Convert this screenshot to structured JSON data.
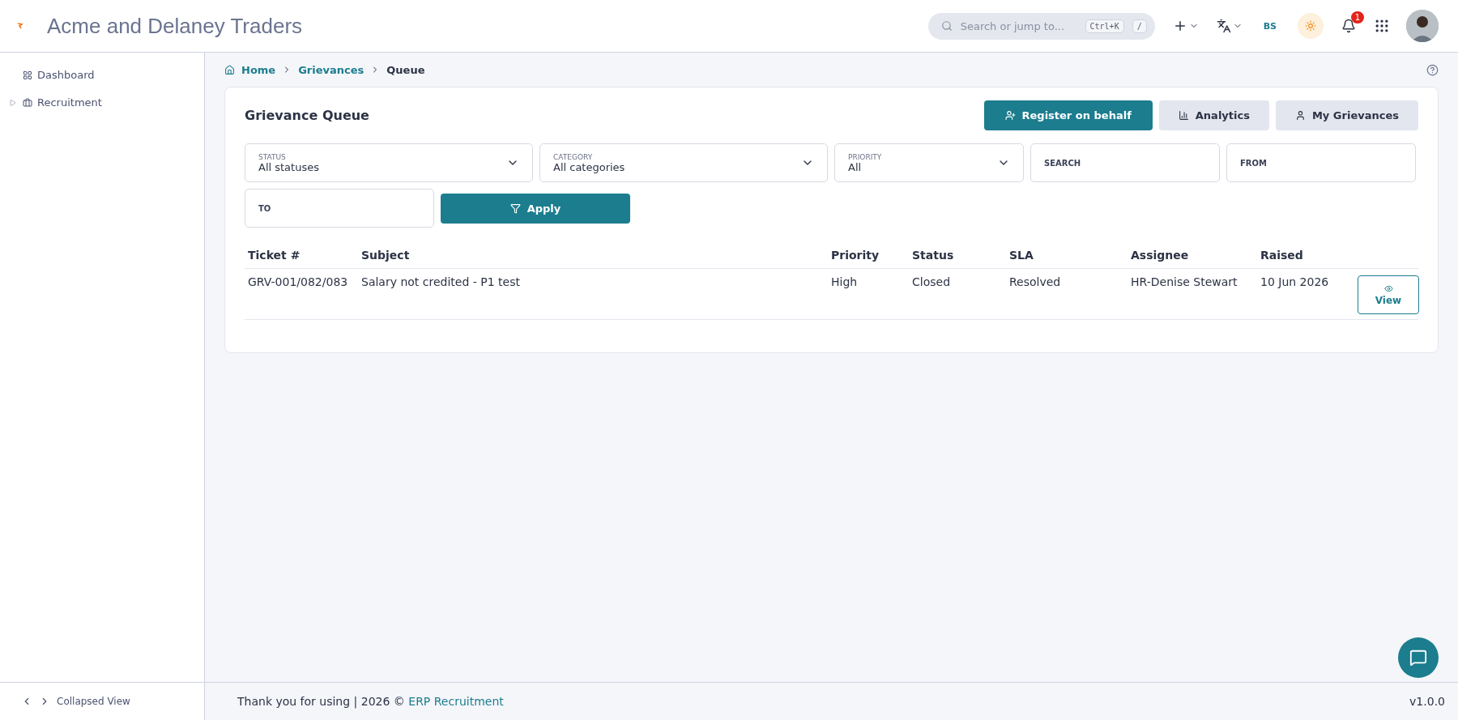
{
  "header": {
    "title": "Acme and Delaney Traders",
    "search": {
      "placeholder": "Search or jump to...",
      "shortcuts": [
        "Ctrl+K",
        "/"
      ]
    },
    "user_initials": "BS",
    "notifications": "1"
  },
  "sidebar": {
    "items": [
      {
        "label": "Dashboard",
        "expandable": false
      },
      {
        "label": "Recruitment",
        "expandable": true
      }
    ],
    "footer": "Collapsed View"
  },
  "breadcrumb": [
    {
      "label": "Home",
      "selected": false
    },
    {
      "label": "Grievances",
      "selected": false
    },
    {
      "label": "Queue",
      "selected": true
    }
  ],
  "card": {
    "title": "Grievance Queue",
    "actions": [
      {
        "label": "Register on behalf",
        "kind": "primary"
      },
      {
        "label": "Analytics",
        "kind": "secondary"
      },
      {
        "label": "My Grievances",
        "kind": "secondary"
      }
    ],
    "filters": [
      {
        "label": "STATUS",
        "value": "All statuses",
        "kind": "select"
      },
      {
        "label": "CATEGORY",
        "value": "All categories",
        "kind": "select"
      },
      {
        "label": "PRIORITY",
        "value": "All",
        "kind": "select"
      },
      {
        "label": "SEARCH",
        "kind": "input"
      },
      {
        "label": "FROM",
        "kind": "input"
      },
      {
        "label": "TO",
        "kind": "input"
      }
    ],
    "apply": "Apply",
    "table": {
      "columns": [
        "Ticket #",
        "Subject",
        "Priority",
        "Status",
        "SLA",
        "Assignee",
        "Raised"
      ],
      "rows": [
        {
          "cells": [
            "GRV-001/082/083",
            "Salary not credited - P1 test",
            "High",
            "Closed",
            "Resolved",
            "HR-Denise Stewart",
            "10 Jun 2026"
          ],
          "action": "View"
        }
      ]
    }
  },
  "footer": {
    "text": "Thank you for using | 2026 © ",
    "link": "ERP Recruitment",
    "version": "v1.0.0"
  }
}
